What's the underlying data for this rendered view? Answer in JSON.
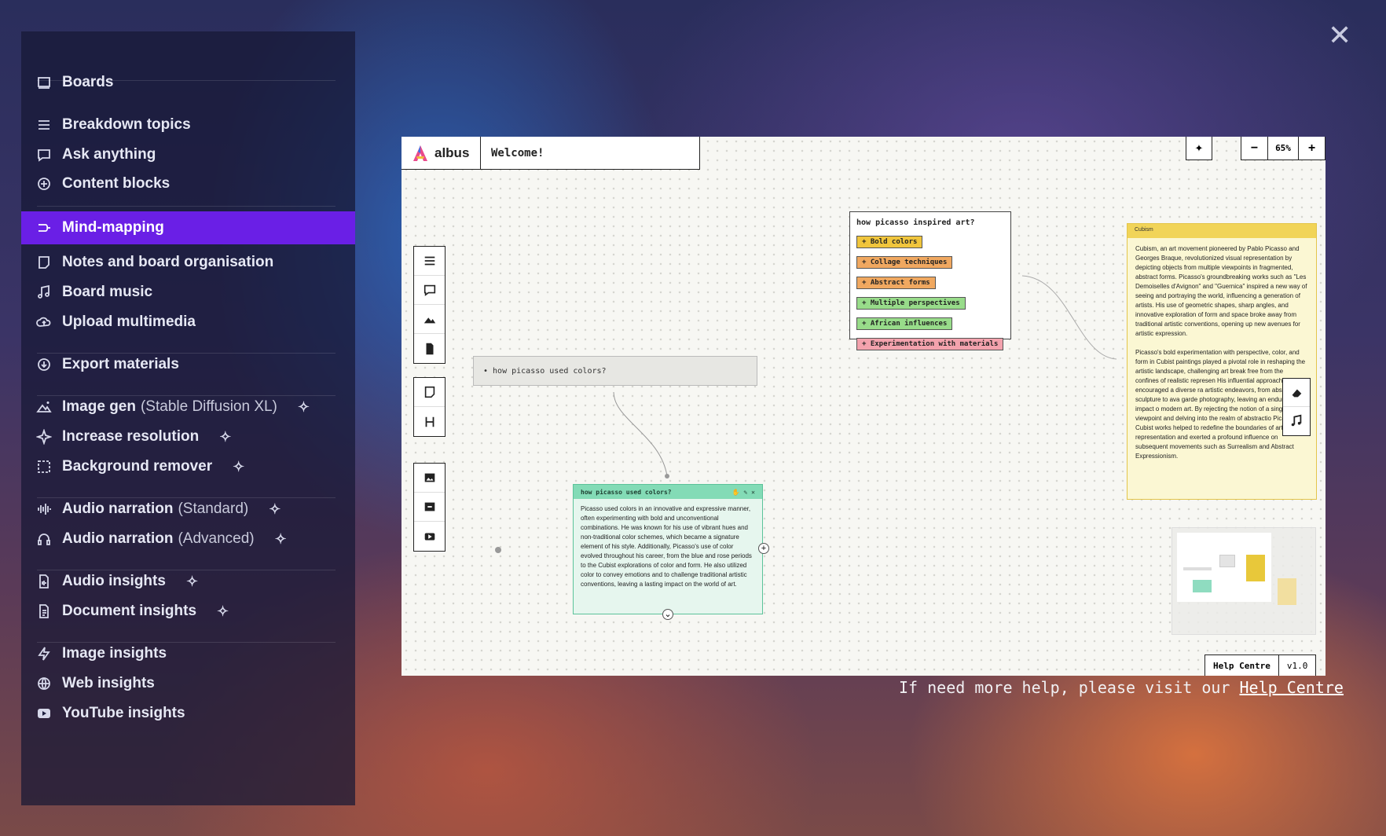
{
  "overlay": {
    "close_label": "✕"
  },
  "sidebar": {
    "items": [
      {
        "label": "Boards",
        "icon": "board-icon"
      },
      {
        "label": "Breakdown topics",
        "icon": "list-icon"
      },
      {
        "label": "Ask anything",
        "icon": "chat-icon"
      },
      {
        "label": "Content blocks",
        "icon": "plus-circle-icon"
      },
      {
        "label": "Mind-mapping",
        "icon": "mindmap-icon",
        "active": true
      },
      {
        "label": "Notes and board organisation",
        "icon": "note-icon"
      },
      {
        "label": "Board music",
        "icon": "music-icon"
      },
      {
        "label": "Upload multimedia",
        "icon": "cloud-upload-icon"
      },
      {
        "label": "Export materials",
        "icon": "download-icon"
      },
      {
        "label": "Image gen",
        "suffix": "(Stable Diffusion XL)",
        "icon": "image-gen-icon",
        "ai": true
      },
      {
        "label": "Increase resolution",
        "icon": "sparkle-icon",
        "ai": true
      },
      {
        "label": "Background remover",
        "icon": "dashed-square-icon",
        "ai": true
      },
      {
        "label": "Audio narration",
        "suffix": "(Standard)",
        "icon": "waveform-icon",
        "ai": true
      },
      {
        "label": "Audio narration",
        "suffix": "(Advanced)",
        "icon": "headphones-icon",
        "ai": true
      },
      {
        "label": "Audio insights",
        "icon": "audio-file-icon",
        "ai": true
      },
      {
        "label": "Document insights",
        "icon": "document-icon",
        "ai": true
      },
      {
        "label": "Image insights",
        "icon": "bolt-icon"
      },
      {
        "label": "Web insights",
        "icon": "globe-icon"
      },
      {
        "label": "YouTube insights",
        "icon": "youtube-icon"
      }
    ]
  },
  "app": {
    "logo_text": "albus",
    "board_title": "Welcome!",
    "zoom": {
      "minus": "−",
      "value": "65%",
      "plus": "+"
    },
    "note_simple": "• how picasso used colors?",
    "mind_map": {
      "title": "how picasso inspired art?",
      "chips": [
        {
          "label": "+ Bold colors",
          "color": "yellow"
        },
        {
          "label": "+ Collage techniques",
          "color": "orange"
        },
        {
          "label": "+ Abstract forms",
          "color": "orange"
        },
        {
          "label": "+ Multiple perspectives",
          "color": "green"
        },
        {
          "label": "+ African influences",
          "color": "green"
        },
        {
          "label": "+ Experimentation with materials",
          "color": "pink"
        }
      ]
    },
    "green_card": {
      "title": "how picasso used colors?",
      "body": "Picasso used colors in an innovative and expressive manner, often experimenting with bold and unconventional combinations. He was known for his use of vibrant hues and non-traditional color schemes, which became a signature element of his style. Additionally, Picasso's use of color evolved throughout his career, from the blue and rose periods to the Cubist explorations of color and form. He also utilized color to convey emotions and to challenge traditional artistic conventions, leaving a lasting impact on the world of art."
    },
    "yellow_card": {
      "title": "Cubism",
      "para1": "Cubism, an art movement pioneered by Pablo Picasso and Georges Braque, revolutionized visual representation by depicting objects from multiple viewpoints in fragmented, abstract forms. Picasso's groundbreaking works such as \"Les Demoiselles d'Avignon\" and \"Guernica\" inspired a new way of seeing and portraying the world, influencing a generation of artists. His use of geometric shapes, sharp angles, and innovative exploration of form and space broke away from traditional artistic conventions, opening up new avenues for artistic expression.",
      "para2": "Picasso's bold experimentation with perspective, color, and form in Cubist paintings played a pivotal role in reshaping the artistic landscape, challenging art break free from the confines of realistic represen His influential approach encouraged a diverse ra artistic endeavors, from abstract sculpture to ava garde photography, leaving an enduring impact o modern art. By rejecting the notion of a single fix viewpoint and delving into the realm of abstractio Picasso's Cubist works helped to redefine the boundaries of artistic representation and exerted a profound influence on subsequent movements such as Surrealism and Abstract Expressionism."
    },
    "help": {
      "label": "Help Centre",
      "version": "v1.0"
    }
  },
  "footer": {
    "help_text": "If need more help, please visit our",
    "help_link": "Help Centre"
  }
}
